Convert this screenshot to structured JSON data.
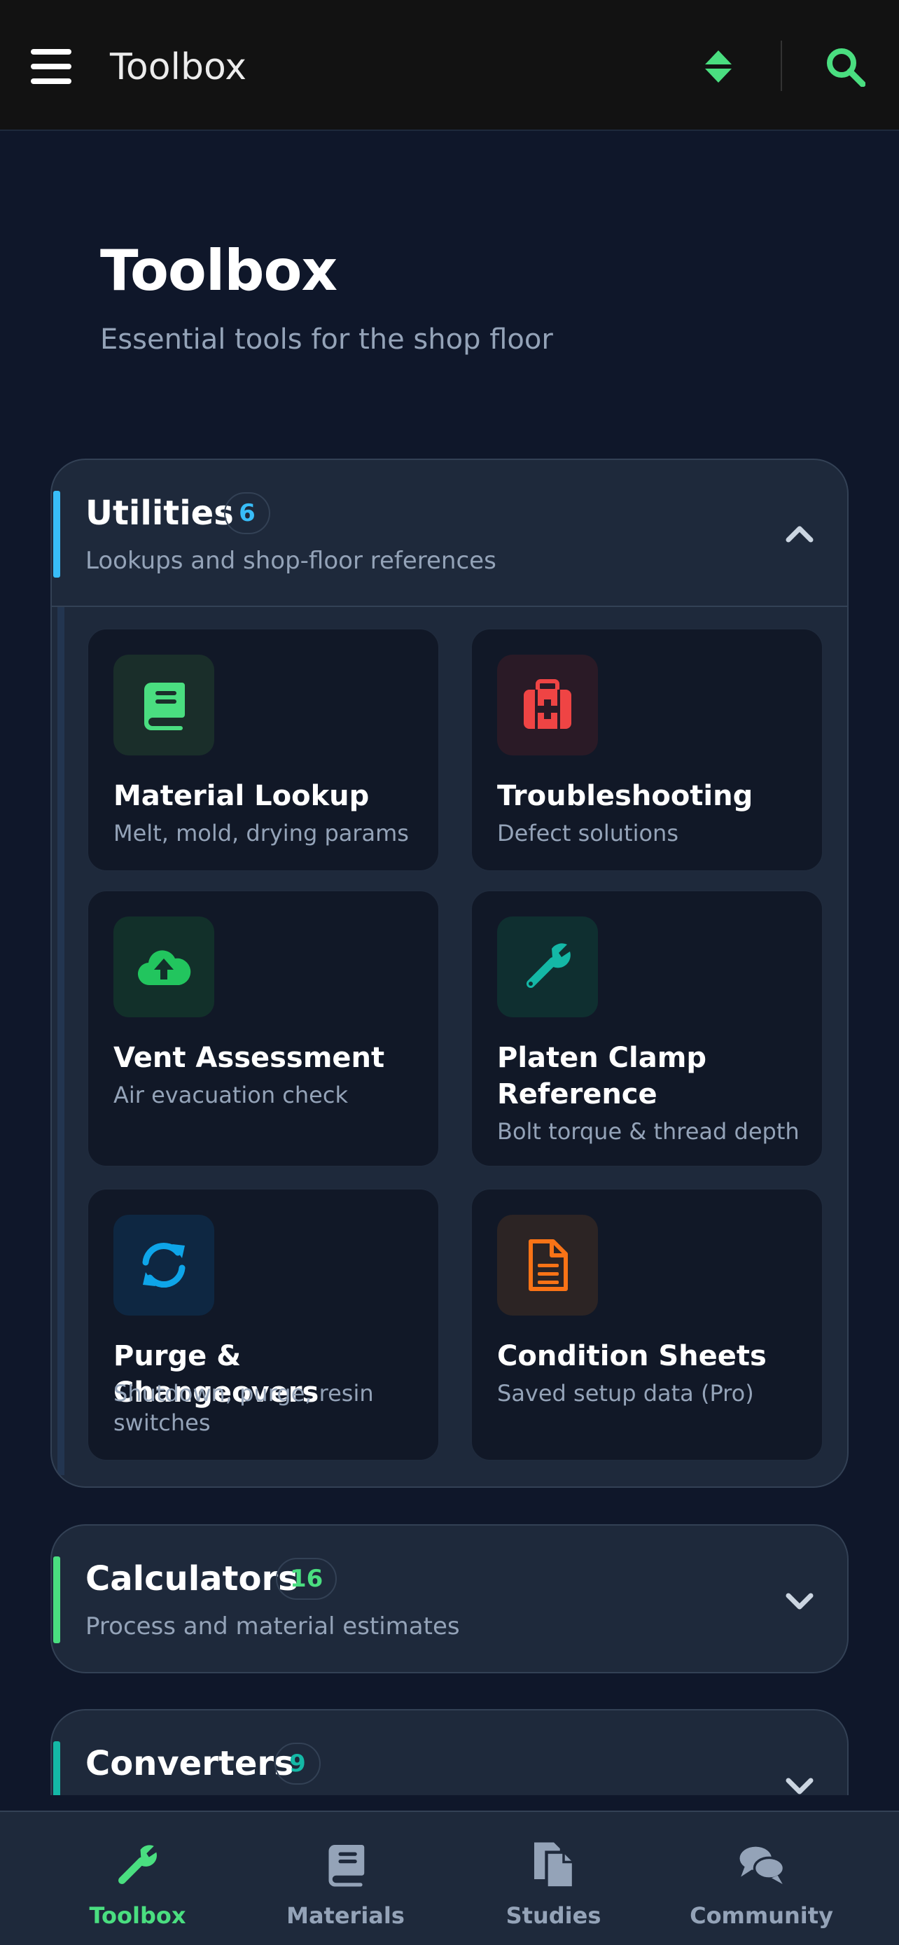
{
  "app_bar": {
    "title": "Toolbox"
  },
  "hero": {
    "title": "Toolbox",
    "subtitle": "Essential tools for the shop floor"
  },
  "sections": [
    {
      "title": "Utilities",
      "count": "6",
      "subtitle": "Lookups and shop-floor references",
      "accent": "#38bdf8",
      "expanded": true,
      "cards": [
        {
          "title": "Material Lookup",
          "desc": "Melt, mold, drying params",
          "icon": "book-icon",
          "icon_color": "#4ade80",
          "icon_bg": "#1a2e2a"
        },
        {
          "title": "Troubleshooting",
          "desc": "Defect solutions",
          "icon": "medkit-icon",
          "icon_color": "#ef4444",
          "icon_bg": "#2a1a26"
        },
        {
          "title": "Vent Assessment",
          "desc": "Air evacuation check",
          "icon": "cloud-upload-icon",
          "icon_color": "#22c55e",
          "icon_bg": "#12302a"
        },
        {
          "title": "Platen Clamp Reference",
          "desc": "Bolt torque & thread depth",
          "icon": "wrench-icon",
          "icon_color": "#14b8a6",
          "icon_bg": "#0f2f30"
        },
        {
          "title": "Purge & Changeovers",
          "desc": "Shutdown, purge, resin switches",
          "icon": "sync-icon",
          "icon_color": "#0ea5e9",
          "icon_bg": "#0e2742"
        },
        {
          "title": "Condition Sheets",
          "desc": "Saved setup data (Pro)",
          "icon": "document-icon",
          "icon_color": "#f97316",
          "icon_bg": "#2c2424"
        }
      ]
    },
    {
      "title": "Calculators",
      "count": "16",
      "subtitle": "Process and material estimates",
      "accent": "#4ade80",
      "expanded": false
    },
    {
      "title": "Converters",
      "count": "9",
      "subtitle": "",
      "accent": "#14b8a6",
      "expanded": false
    }
  ],
  "bottom_nav": {
    "items": [
      {
        "label": "Toolbox",
        "icon": "wrench-icon",
        "active": true
      },
      {
        "label": "Materials",
        "icon": "book-icon",
        "active": false
      },
      {
        "label": "Studies",
        "icon": "documents-icon",
        "active": false
      },
      {
        "label": "Community",
        "icon": "chat-icon",
        "active": false
      }
    ]
  },
  "colors": {
    "background": "#0f172a",
    "app_bar": "#121212",
    "accent_green": "#4ade80",
    "panel": "#1e293b"
  }
}
